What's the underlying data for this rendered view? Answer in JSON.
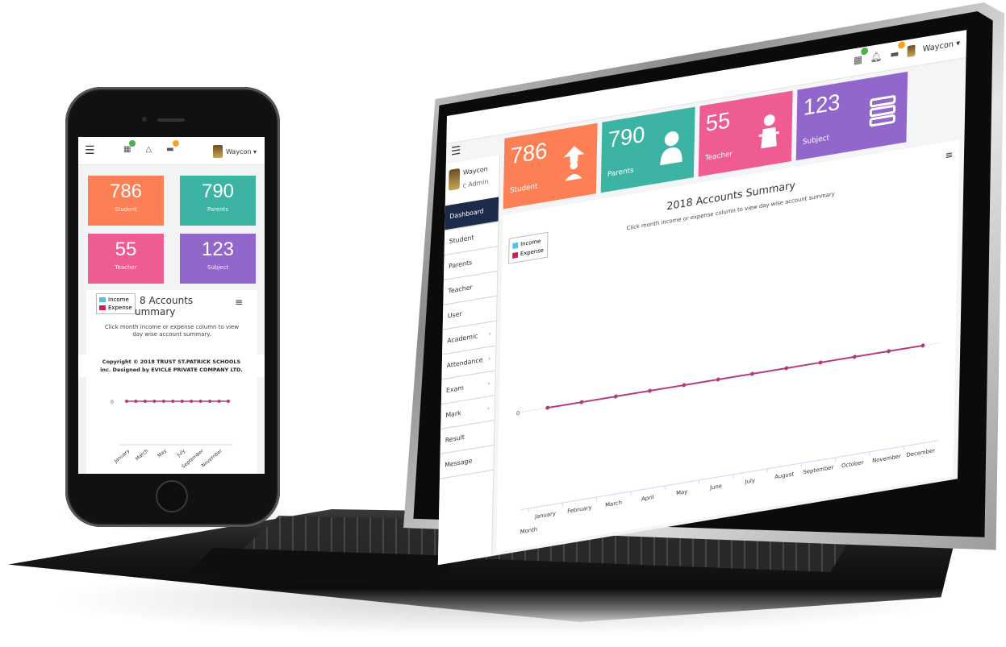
{
  "colors": {
    "students": "#fd7f55",
    "parents": "#3db4a3",
    "teachers": "#ef5c93",
    "subjects": "#9267cc",
    "income": "#4fc3e8",
    "expense": "#cf1e5a",
    "line": "#b23a7e",
    "sidebar_active": "#1d2b4a"
  },
  "laptop": {
    "user": "Waycon ▾",
    "profile": {
      "name": "Waycon",
      "role": "c Admin"
    },
    "sidebar": [
      {
        "label": "Dashboard",
        "active": true,
        "caret": ""
      },
      {
        "label": "Student",
        "active": false,
        "caret": ""
      },
      {
        "label": "Parents",
        "active": false,
        "caret": ""
      },
      {
        "label": "Teacher",
        "active": false,
        "caret": ""
      },
      {
        "label": "User",
        "active": false,
        "caret": ""
      },
      {
        "label": "Academic",
        "active": false,
        "caret": "›"
      },
      {
        "label": "Attendance",
        "active": false,
        "caret": "›"
      },
      {
        "label": "Exam",
        "active": false,
        "caret": "›"
      },
      {
        "label": "Mark",
        "active": false,
        "caret": "›"
      },
      {
        "label": "Result",
        "active": false,
        "caret": ""
      },
      {
        "label": "Message",
        "active": false,
        "caret": ""
      }
    ],
    "cards": [
      {
        "value": "786",
        "label": "Student"
      },
      {
        "value": "790",
        "label": "Parents"
      },
      {
        "value": "55",
        "label": "Teacher"
      },
      {
        "value": "123",
        "label": "Subject"
      }
    ],
    "chart_title": "2018 Accounts Summary",
    "chart_subtitle": "Click month income or expense column to view day wise account summary",
    "legend": {
      "income": "Income",
      "expense": "Expense"
    },
    "menu_icon": "≡"
  },
  "phone": {
    "user": "Waycon ▾",
    "cards": [
      {
        "value": "786",
        "label": "Student"
      },
      {
        "value": "790",
        "label": "Parents"
      },
      {
        "value": "55",
        "label": "Teacher"
      },
      {
        "value": "123",
        "label": "Subject"
      }
    ],
    "title_line1": "8 Accounts",
    "title_line2": "ummary",
    "subtitle": "Click month income or expense column to view day wise account summary.",
    "footer_line1": "Copyright © 2018 TRUST ST.PATRICK SCHOOLS",
    "footer_line2": "inc. Designed by EVICLE PRIVATE COMPANY LTD.",
    "legend": {
      "income": "Income",
      "expense": "Expense"
    },
    "menu_icon": "≡"
  },
  "chart_data": [
    {
      "type": "line",
      "title": "2018 Accounts Summary",
      "xlabel": "Month",
      "ylabel": "",
      "categories": [
        "January",
        "February",
        "March",
        "April",
        "May",
        "June",
        "July",
        "August",
        "September",
        "October",
        "November",
        "December"
      ],
      "series": [
        {
          "name": "Income",
          "values": [
            0,
            0,
            0,
            0,
            0,
            0,
            0,
            0,
            0,
            0,
            0,
            0
          ]
        },
        {
          "name": "Expense",
          "values": [
            0,
            0,
            0,
            0,
            0,
            0,
            0,
            0,
            0,
            0,
            0,
            0
          ]
        }
      ],
      "ytick": "0",
      "legend": "top-left"
    },
    {
      "type": "line",
      "title": "",
      "categories": [
        "January",
        "March",
        "May",
        "July",
        "September",
        "November"
      ],
      "points": 12,
      "series": [
        {
          "name": "Income",
          "values": [
            0,
            0,
            0,
            0,
            0,
            0,
            0,
            0,
            0,
            0,
            0,
            0
          ]
        },
        {
          "name": "Expense",
          "values": [
            0,
            0,
            0,
            0,
            0,
            0,
            0,
            0,
            0,
            0,
            0,
            0
          ]
        }
      ],
      "ytick": "0"
    }
  ]
}
